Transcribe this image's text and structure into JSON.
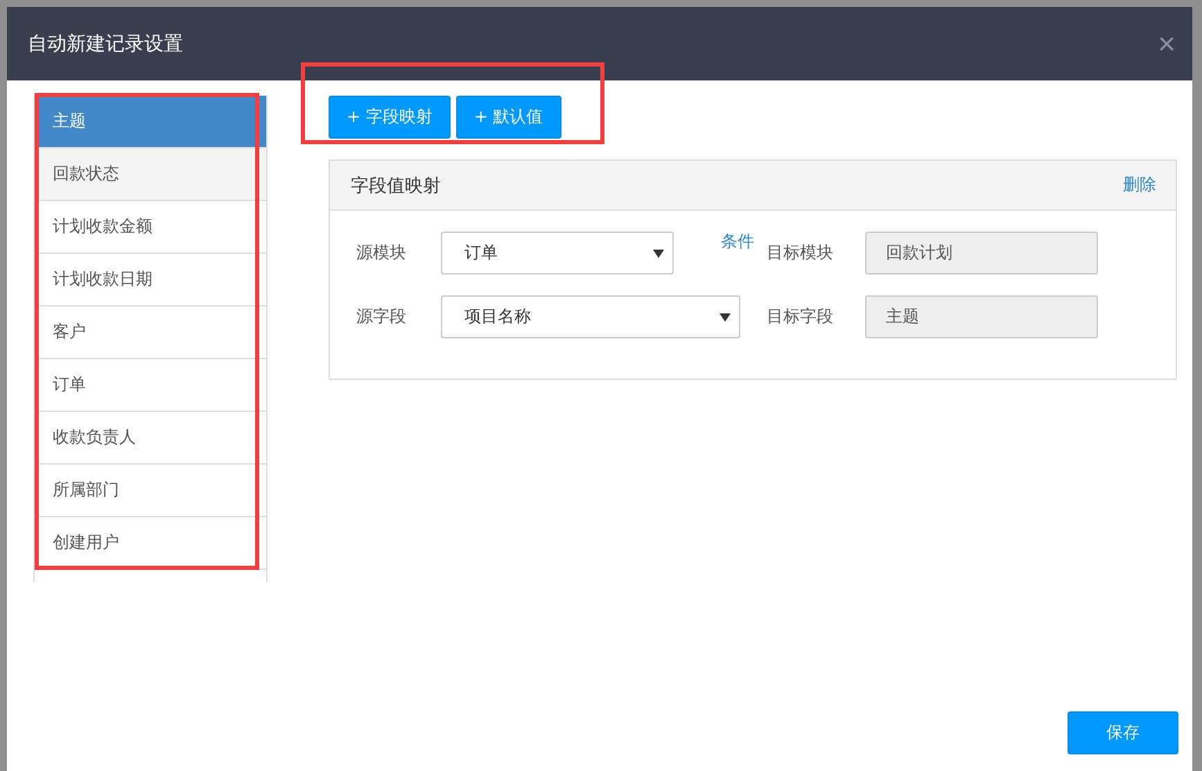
{
  "window": {
    "title": "自动新建记录设置",
    "close": "×"
  },
  "sidebar": {
    "highlighted": true,
    "items": [
      {
        "label": "主题",
        "selected": true,
        "hovered": false
      },
      {
        "label": "回款状态",
        "selected": false,
        "hovered": true
      },
      {
        "label": "计划收款金额",
        "selected": false,
        "hovered": false
      },
      {
        "label": "计划收款日期",
        "selected": false,
        "hovered": false
      },
      {
        "label": "客户",
        "selected": false,
        "hovered": false
      },
      {
        "label": "订单",
        "selected": false,
        "hovered": false
      },
      {
        "label": "收款负责人",
        "selected": false,
        "hovered": false
      },
      {
        "label": "所属部门",
        "selected": false,
        "hovered": false
      },
      {
        "label": "创建用户",
        "selected": false,
        "hovered": false
      }
    ]
  },
  "toolbar": {
    "highlighted": true,
    "buttons": [
      "+ 字段映射",
      "+ 默认值"
    ]
  },
  "mapping": {
    "title": "字段值映射",
    "delete_link": "删除",
    "rows": [
      {
        "label": "源模块",
        "value": "订单",
        "narrow": true,
        "condition_link": "条件",
        "target_label": "目标模块",
        "target_value": "回款计划"
      },
      {
        "label": "源字段",
        "value": "项目名称",
        "narrow": false,
        "target_label": "目标字段",
        "target_value": "主题"
      }
    ]
  },
  "footer": {
    "save": "保存"
  }
}
